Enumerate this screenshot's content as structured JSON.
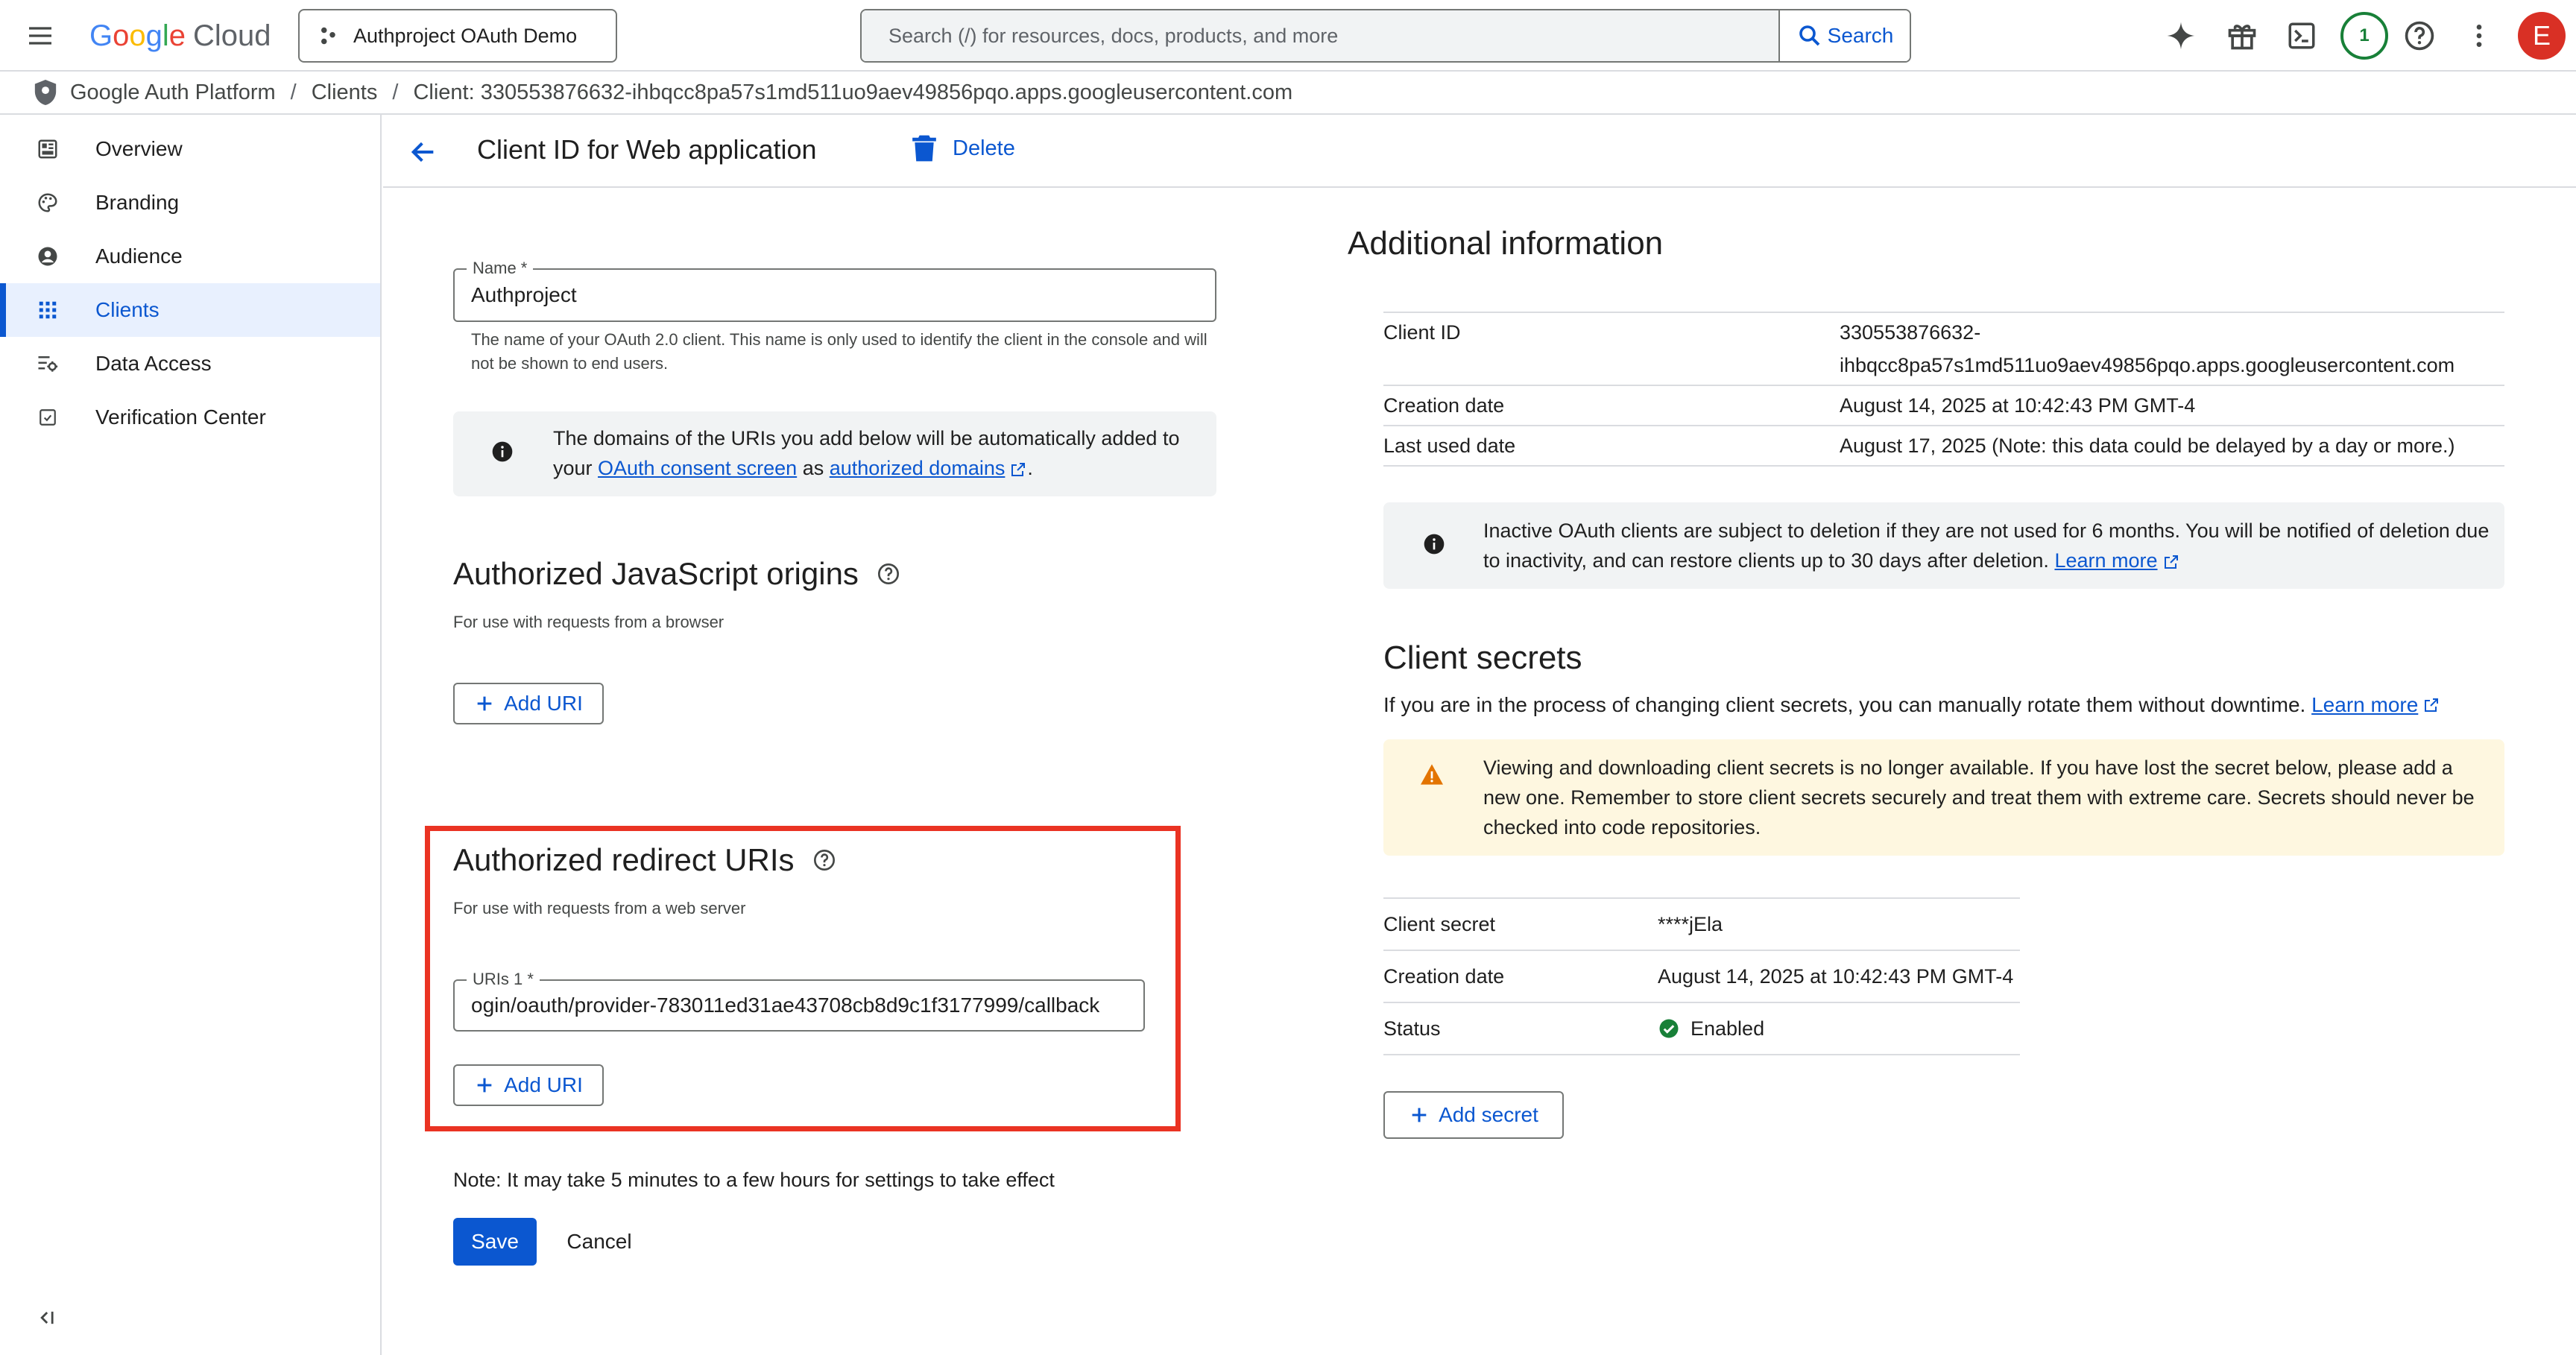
{
  "header": {
    "logo_google": "Google",
    "logo_cloud": "Cloud",
    "project_name": "Authproject OAuth Demo",
    "search_placeholder": "Search (/) for resources, docs, products, and more",
    "search_button": "Search",
    "notification_count": "1",
    "avatar_initial": "E"
  },
  "breadcrumb": {
    "items": [
      "Google Auth Platform",
      "Clients",
      "Client: 330553876632-ihbqcc8pa57s1md511uo9aev49856pqo.apps.googleusercontent.com"
    ]
  },
  "sidebar": {
    "items": [
      {
        "label": "Overview",
        "icon": "dashboard-icon"
      },
      {
        "label": "Branding",
        "icon": "palette-icon"
      },
      {
        "label": "Audience",
        "icon": "person-icon"
      },
      {
        "label": "Clients",
        "icon": "apps-grid-icon",
        "active": true
      },
      {
        "label": "Data Access",
        "icon": "data-access-icon"
      },
      {
        "label": "Verification Center",
        "icon": "verification-icon"
      }
    ]
  },
  "page": {
    "title": "Client ID for Web application",
    "delete_label": "Delete"
  },
  "form": {
    "name_label": "Name *",
    "name_value": "Authproject",
    "name_helper": "The name of your OAuth 2.0 client. This name is only used to identify the client in the console and will not be shown to end users.",
    "domains_info_1": "The domains of the URIs you add below will be automatically added to your ",
    "domains_info_link1": "OAuth consent screen",
    "domains_info_2": " as ",
    "domains_info_link2": "authorized domains",
    "domains_info_3": ".",
    "js_origins_title": "Authorized JavaScript origins",
    "js_origins_sub": "For use with requests from a browser",
    "add_uri_label": "Add URI",
    "redirect_title": "Authorized redirect URIs",
    "redirect_sub": "For use with requests from a web server",
    "uri1_label": "URIs 1 *",
    "uri1_value": "ogin/oauth/provider-783011ed31ae43708cb8d9c1f3177999/callback",
    "note": "Note: It may take 5 minutes to a few hours for settings to take effect",
    "save_label": "Save",
    "cancel_label": "Cancel"
  },
  "additional": {
    "title": "Additional information",
    "rows": [
      {
        "key": "Client ID",
        "value_line1": "330553876632-",
        "value_line2": "ihbqcc8pa57s1md511uo9aev49856pqo.apps.googleusercontent.com"
      },
      {
        "key": "Creation date",
        "value": "August 14, 2025 at 10:42:43 PM GMT-4"
      },
      {
        "key": "Last used date",
        "value": "August 17, 2025 (Note: this data could be delayed by a day or more.)"
      }
    ],
    "inactive_info": "Inactive OAuth clients are subject to deletion if they are not used for 6 months. You will be notified of deletion due to inactivity, and can restore clients up to 30 days after deletion.",
    "learn_more": "Learn more"
  },
  "secrets": {
    "title": "Client secrets",
    "subtitle": "If you are in the process of changing client secrets, you can manually rotate them without downtime.",
    "learn_more": "Learn more",
    "warning": "Viewing and downloading client secrets is no longer available. If you have lost the secret below, please add a new one. Remember to store client secrets securely and treat them with extreme care. Secrets should never be checked into code repositories.",
    "rows": [
      {
        "key": "Client secret",
        "value": "****jEla"
      },
      {
        "key": "Creation date",
        "value": "August 14, 2025 at 10:42:43 PM GMT-4"
      },
      {
        "key": "Status",
        "value": "Enabled"
      }
    ],
    "add_secret_label": "Add secret"
  },
  "colors": {
    "primary": "#0b57d0",
    "highlight": "#ea3323",
    "success": "#188038",
    "warning": "#e37400"
  }
}
